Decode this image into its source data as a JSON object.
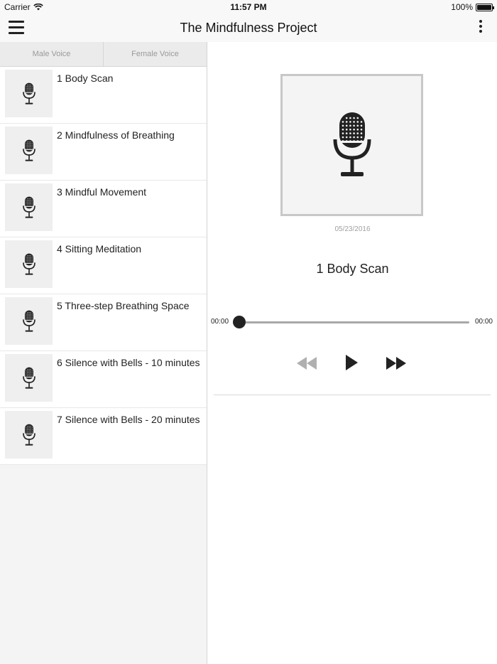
{
  "status_bar": {
    "carrier": "Carrier",
    "time": "11:57 PM",
    "battery_text": "100%",
    "battery_level": 1.0
  },
  "nav": {
    "title": "The Mindfulness Project",
    "menu_icon": "hamburger-menu-icon",
    "more_icon": "vertical-ellipsis-icon"
  },
  "tabs": [
    {
      "label": "Male Voice"
    },
    {
      "label": "Female Voice"
    }
  ],
  "tracks": [
    {
      "label": "1 Body Scan",
      "icon": "microphone-icon"
    },
    {
      "label": "2 Mindfulness of Breathing",
      "icon": "microphone-icon"
    },
    {
      "label": "3 Mindful Movement",
      "icon": "microphone-icon"
    },
    {
      "label": "4 Sitting Meditation",
      "icon": "microphone-icon"
    },
    {
      "label": "5 Three-step Breathing Space",
      "icon": "microphone-icon"
    },
    {
      "label": "6 Silence with Bells - 10 minutes",
      "icon": "microphone-icon"
    },
    {
      "label": "7 Silence with Bells - 20 minutes",
      "icon": "microphone-icon"
    }
  ],
  "player": {
    "date": "05/23/2016",
    "title": "1 Body Scan",
    "elapsed": "00:00",
    "duration": "00:00",
    "progress": 0,
    "icons": {
      "artwork": "microphone-icon",
      "rewind": "rewind-icon",
      "play": "play-icon",
      "fast_forward": "fast-forward-icon"
    }
  },
  "colors": {
    "controls_active": "#222222",
    "controls_inactive": "#b0b0b0",
    "tab_text": "#9a9a9a"
  }
}
